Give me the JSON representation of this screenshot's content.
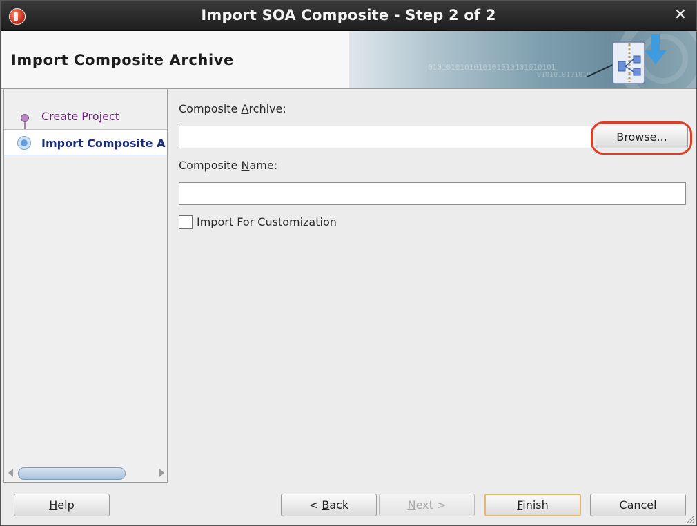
{
  "window": {
    "title": "Import SOA Composite - Step 2 of 2"
  },
  "banner": {
    "title": "Import Composite Archive",
    "binary_text_1": "0101010101010101010101010101",
    "binary_text_2": "0101010101010"
  },
  "steps": {
    "items": [
      {
        "label": "Create Project",
        "state": "visited"
      },
      {
        "label": "Import Composite Archive",
        "display": "Import Composite A",
        "state": "current"
      }
    ]
  },
  "form": {
    "composite_archive": {
      "label_pre": "Composite ",
      "label_mnemonic": "A",
      "label_post": "rchive:",
      "value": ""
    },
    "browse_button": {
      "mnemonic": "B",
      "rest": "rowse..."
    },
    "composite_name": {
      "label_pre": "Composite ",
      "label_mnemonic": "N",
      "label_post": "ame:",
      "value": ""
    },
    "import_for_customization": {
      "label": "Import For Customization",
      "checked": false
    }
  },
  "footer": {
    "help": {
      "mnemonic": "H",
      "rest": "elp"
    },
    "back": {
      "pre": "< ",
      "mnemonic": "B",
      "rest": "ack"
    },
    "next": {
      "mnemonic": "N",
      "rest": "ext >"
    },
    "finish": {
      "mnemonic": "F",
      "rest": "inish"
    },
    "cancel": {
      "label": "Cancel"
    }
  },
  "colors": {
    "title_bar": "#2a2a2a",
    "highlight_ring": "#e03d26",
    "visited_link": "#6a1f7a",
    "current_step": "#1a2e7a",
    "default_button_border": "#e8b76a"
  },
  "icons": [
    "app-logo-icon",
    "close-icon",
    "import-archive-icon",
    "scroll-left-icon",
    "scroll-right-icon",
    "resize-grip-icon"
  ]
}
